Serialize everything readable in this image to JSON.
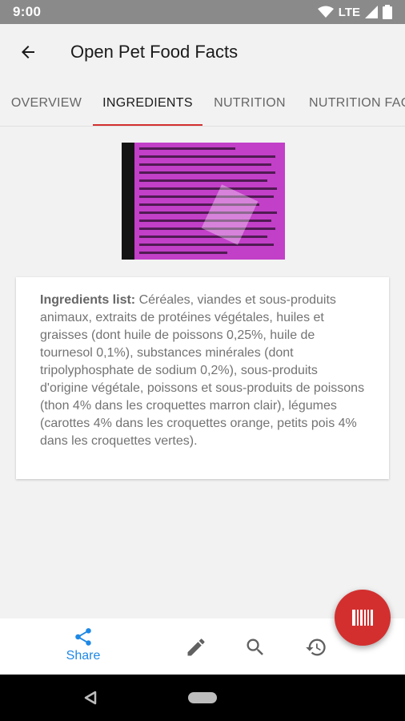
{
  "status_bar": {
    "time": "9:00",
    "network": "LTE"
  },
  "app_bar": {
    "title": "Open Pet Food Facts"
  },
  "tabs": [
    {
      "label": "OVERVIEW",
      "active": false
    },
    {
      "label": "INGREDIENTS",
      "active": true
    },
    {
      "label": "NUTRITION",
      "active": false
    },
    {
      "label": "NUTRITION FAC",
      "active": false
    }
  ],
  "ingredients": {
    "label": "Ingredients list:",
    "text": "Céréales, viandes et sous-produits animaux, extraits de protéines végétales, huiles et graisses (dont huile de poissons 0,25%, huile de tournesol 0,1%), substances minérales (dont tripolyphosphate de sodium 0,2%), sous-produits d'origine végétale, poissons et sous-produits de poissons (thon 4% dans les croquettes marron clair), légumes (carottes 4% dans les croquettes orange, petits pois 4% dans les croquettes vertes)."
  },
  "bottom_nav": {
    "share_label": "Share"
  },
  "icons": {
    "back": "arrow-left-icon",
    "share": "share-icon",
    "edit": "pencil-icon",
    "search": "search-icon",
    "history": "history-icon",
    "scan": "barcode-icon"
  },
  "colors": {
    "accent": "#d32f2f",
    "share": "#1e88e5"
  }
}
